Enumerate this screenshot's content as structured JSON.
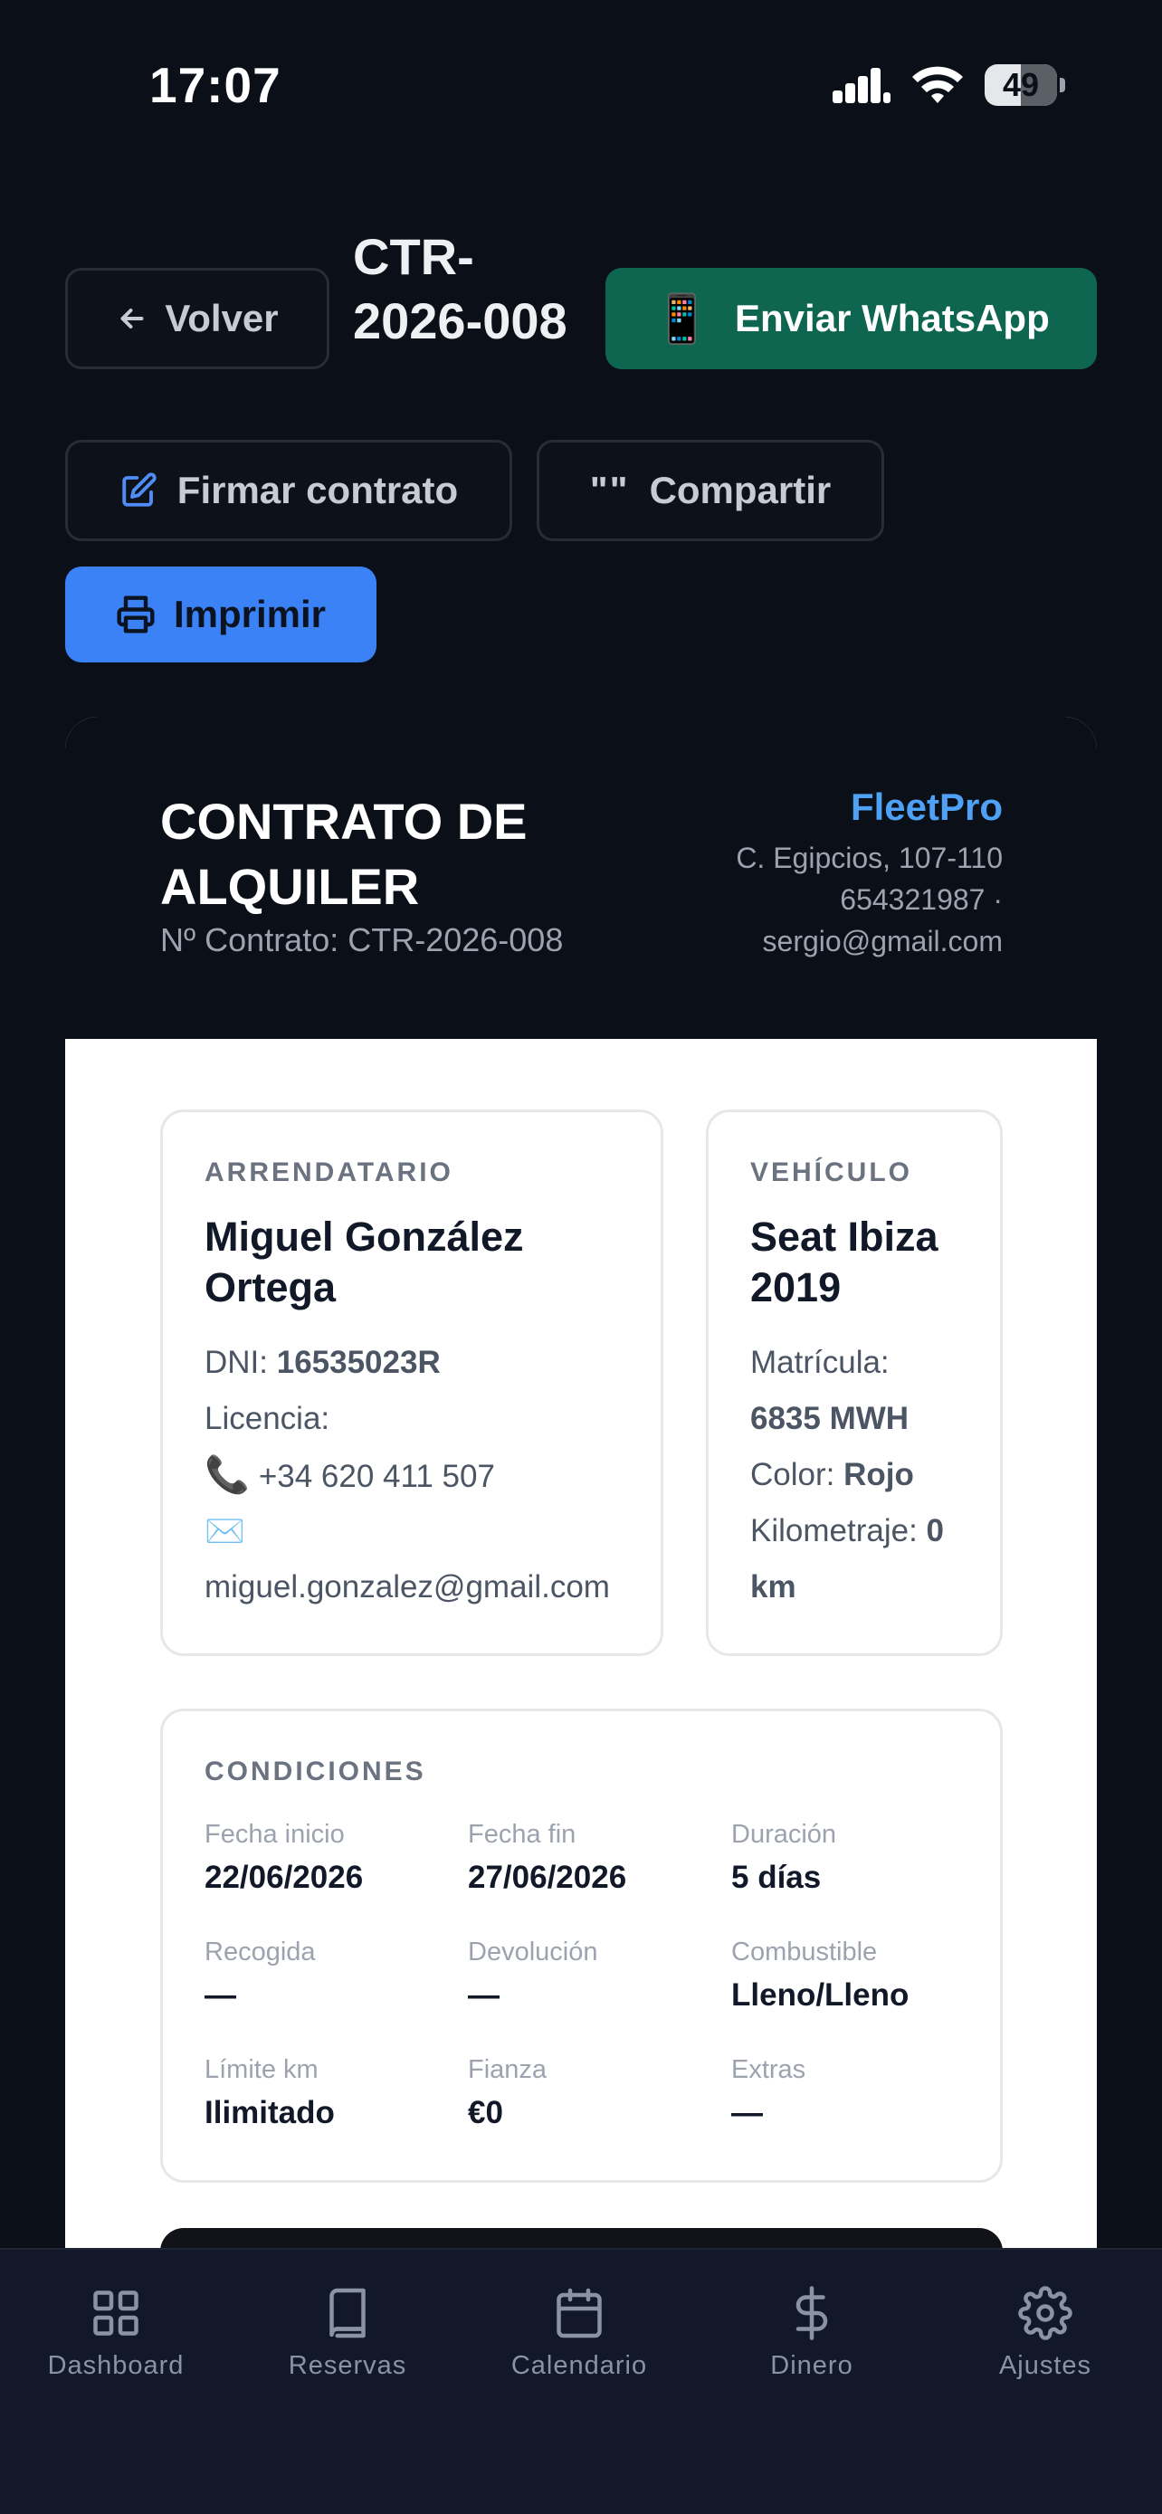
{
  "status_bar": {
    "time": "17:07",
    "battery": "49"
  },
  "header": {
    "back_label": "Volver",
    "doc_title": "CTR-2026-008",
    "whatsapp_label": "Enviar WhatsApp",
    "whatsapp_emoji": "📱",
    "sign_label": "Firmar contrato",
    "share_label": "Compartir",
    "share_glyph": "\"\"",
    "print_label": "Imprimir"
  },
  "contract": {
    "heading": "CONTRATO DE ALQUILER",
    "number": "Nº Contrato: CTR-2026-008",
    "company": {
      "name": "FleetPro",
      "address": "C. Egipcios, 107-110",
      "phone": "654321987 ·",
      "email": "sergio@gmail.com"
    },
    "tenant": {
      "label": "ARRENDATARIO",
      "name": "Miguel González Ortega",
      "dni_label": "DNI:",
      "dni": "16535023R",
      "license_label": "Licencia:",
      "phone": "+34 620 411 507",
      "email": "miguel.gonzalez@gmail.com"
    },
    "vehicle": {
      "label": "VEHÍCULO",
      "name": "Seat Ibiza 2019",
      "plate_label": "Matrícula:",
      "plate": "6835 MWH",
      "color_label": "Color:",
      "color": "Rojo",
      "km_label": "Kilometraje:",
      "km_value": "0",
      "km_unit": "km"
    },
    "conditions": {
      "label": "CONDICIONES",
      "items": [
        {
          "label": "Fecha inicio",
          "value": "22/06/2026"
        },
        {
          "label": "Fecha fin",
          "value": "27/06/2026"
        },
        {
          "label": "Duración",
          "value": "5 días"
        },
        {
          "label": "Recogida",
          "value": "—"
        },
        {
          "label": "Devolución",
          "value": "—"
        },
        {
          "label": "Combustible",
          "value": "Lleno/Lleno"
        },
        {
          "label": "Límite km",
          "value": "Ilimitado"
        },
        {
          "label": "Fianza",
          "value": "€0"
        },
        {
          "label": "Extras",
          "value": "—"
        }
      ]
    }
  },
  "tabs": [
    {
      "label": "Dashboard",
      "icon": "grid-icon"
    },
    {
      "label": "Reservas",
      "icon": "book-icon"
    },
    {
      "label": "Calendario",
      "icon": "calendar-icon"
    },
    {
      "label": "Dinero",
      "icon": "dollar-icon"
    },
    {
      "label": "Ajustes",
      "icon": "gear-icon"
    }
  ],
  "colors": {
    "background": "#0b0f17",
    "whatsapp": "#0f6650",
    "print": "#3b82f6",
    "brand": "#4ea1f5"
  }
}
